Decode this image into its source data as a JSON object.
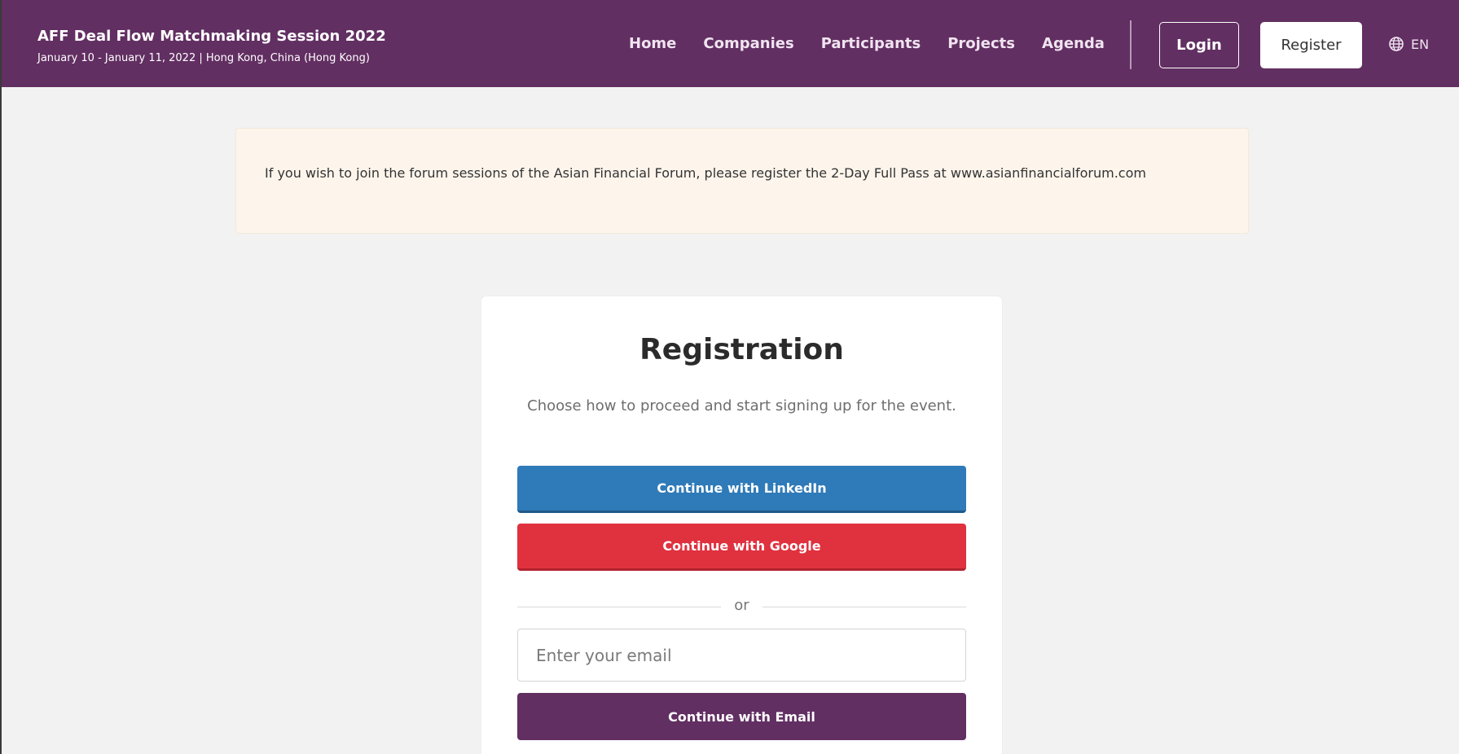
{
  "header": {
    "event_title": "AFF Deal Flow Matchmaking Session 2022",
    "event_subtitle": "January 10 - January 11, 2022 | Hong Kong, China (Hong Kong)",
    "nav": [
      "Home",
      "Companies",
      "Participants",
      "Projects",
      "Agenda"
    ],
    "login_label": "Login",
    "register_label": "Register",
    "language": "EN",
    "language_icon": "globe-icon"
  },
  "notice": {
    "text": "If you wish to join the forum sessions of the Asian Financial Forum, please register the 2-Day Full Pass at www.asianfinancialforum.com"
  },
  "registration": {
    "title": "Registration",
    "subtitle": "Choose how to proceed and start signing up for the event.",
    "linkedin_label": "Continue with LinkedIn",
    "google_label": "Continue with Google",
    "or_label": "or",
    "email_placeholder": "Enter your email",
    "email_button_label": "Continue with Email"
  },
  "colors": {
    "header_bg": "#622f62",
    "linkedin": "#2f7ab8",
    "google": "#e0313f",
    "email_button": "#622f62",
    "notice_bg": "#fdf5ec"
  }
}
